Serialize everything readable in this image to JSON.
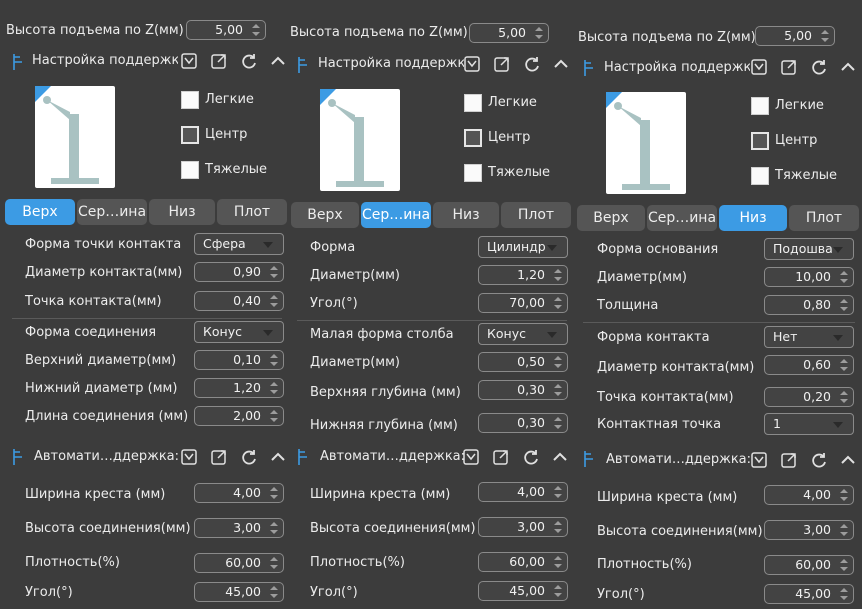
{
  "z_label": "Высота подъема по Z(мм)",
  "z_value": "5,00",
  "support_settings_title": "Настройка поддержки",
  "density": {
    "light": "Легкие",
    "center": "Центр",
    "heavy": "Тяжелые"
  },
  "tabs": {
    "top": "Верх",
    "middle": "Сер…ина",
    "bottom": "Низ",
    "plate": "Плот"
  },
  "auto_title": "Автомати…ддержка:",
  "auto_rows": {
    "cross_width": {
      "label": "Ширина креста (мм)",
      "value": "4,00"
    },
    "joint_height": {
      "label": "Высота соединения(мм)",
      "value": "3,00"
    },
    "density": {
      "label": "Плотность(%)",
      "value": "60,00"
    },
    "angle": {
      "label": "Угол(°)",
      "value": "45,00"
    }
  },
  "panel1": {
    "contact_shape": {
      "label": "Форма точки контакта",
      "value": "Сфера"
    },
    "contact_diameter": {
      "label": "Диаметр контакта(мм)",
      "value": "0,90"
    },
    "contact_point": {
      "label": "Точка контакта(мм)",
      "value": "0,40"
    },
    "joint_shape": {
      "label": "Форма соединения",
      "value": "Конус"
    },
    "upper_diameter": {
      "label": "Верхний диаметр(мм)",
      "value": "0,10"
    },
    "lower_diameter": {
      "label": "Нижний диаметр (мм)",
      "value": "1,20"
    },
    "joint_length": {
      "label": "Длина соединения (мм)",
      "value": "2,00"
    }
  },
  "panel2": {
    "shape": {
      "label": "Форма",
      "value": "Цилиндр"
    },
    "diameter": {
      "label": "Диаметр(мм)",
      "value": "1,20"
    },
    "angle": {
      "label": "Угол(°)",
      "value": "70,00"
    },
    "small_pillar_shape": {
      "label": "Малая форма столба",
      "value": "Конус"
    },
    "small_diameter": {
      "label": "Диаметр(мм)",
      "value": "0,50"
    },
    "upper_depth": {
      "label": "Верхняя глубина (мм)",
      "value": "0,30"
    },
    "lower_depth": {
      "label": "Нижняя глубина (мм)",
      "value": "0,30"
    }
  },
  "panel3": {
    "base_shape": {
      "label": "Форма основания",
      "value": "Подошва"
    },
    "diameter": {
      "label": "Диаметр(мм)",
      "value": "10,00"
    },
    "thickness": {
      "label": "Толщина",
      "value": "0,80"
    },
    "contact_shape": {
      "label": "Форма контакта",
      "value": "Нет"
    },
    "contact_diameter": {
      "label": "Диаметр контакта(мм)",
      "value": "0,60"
    },
    "contact_point": {
      "label": "Точка контакта(мм)",
      "value": "0,20"
    },
    "contact_dot": {
      "label": "Контактная точка",
      "value": "1"
    }
  },
  "colors": {
    "accent": "#3c9be4",
    "panel": "#3c3c3c",
    "preview_support": "#a9c2c2"
  }
}
